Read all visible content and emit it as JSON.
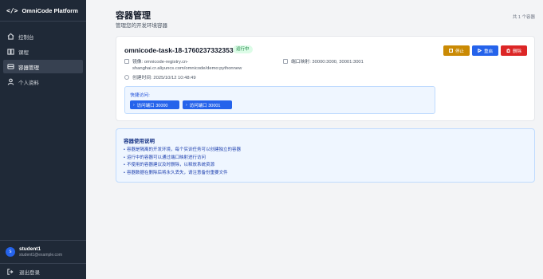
{
  "brand": {
    "logo": "</>",
    "name": "OmniCode Platform"
  },
  "sidebar": {
    "items": [
      {
        "label": "控制台",
        "icon": "home-icon",
        "active": false
      },
      {
        "label": "课程",
        "icon": "book-icon",
        "active": false
      },
      {
        "label": "容器管理",
        "icon": "container-icon",
        "active": true
      },
      {
        "label": "个人资料",
        "icon": "user-icon",
        "active": false
      }
    ]
  },
  "user": {
    "avatar": "s",
    "name": "student1",
    "email": "student1@example.com",
    "logout": "退出登录"
  },
  "header": {
    "title": "容器管理",
    "subtitle": "管理您的开发环境容器",
    "total": "共 1 个容器"
  },
  "container": {
    "name": "omnicode-task-18-1760237332353",
    "status": "运行中",
    "image_line1": "镜像: omnicode-registry.cn-",
    "image_line2": "shanghai.cr.aliyuncs.com/omnicode/demo:pythonnew",
    "ports": "端口映射: 30000:3000, 30001:3001",
    "created": "创建时间: 2025/10/12 10:48:49",
    "actions": {
      "stop": "停止",
      "restart": "重启",
      "delete": "删除"
    },
    "quick_access": {
      "label": "快捷访问:",
      "ports": [
        "访问端口 30000",
        "访问端口 30001"
      ]
    }
  },
  "info": {
    "title": "容器使用说明",
    "items": [
      "容器是隔离的开发环境，每个实训任务可以创建独立的容器",
      "运行中的容器可以通过端口映射进行访问",
      "不使用的容器建议及时删除，以释放系统资源",
      "容器数据在删除后将永久丢失，请注意备份重要文件"
    ]
  },
  "colors": {
    "sidebar_bg": "#1f2937",
    "accent": "#2563eb",
    "stop": "#ca8a04",
    "delete": "#dc2626",
    "running": "#15803d"
  }
}
